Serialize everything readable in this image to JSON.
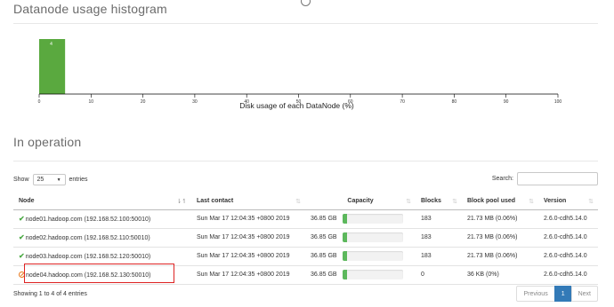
{
  "histogram": {
    "title": "Datanode usage histogram"
  },
  "chart_data": {
    "type": "bar",
    "title": "",
    "xlabel": "Disk usage of each DataNode (%)",
    "ylabel": "",
    "xlim": [
      0,
      100
    ],
    "x_ticks": [
      0,
      10,
      20,
      30,
      40,
      50,
      60,
      70,
      80,
      90,
      100
    ],
    "bins": [
      {
        "start": 0,
        "end": 5,
        "count": 4
      }
    ],
    "bar_color": "#5aa93f",
    "grid": false
  },
  "operation": {
    "title": "In operation",
    "show_label": "Show",
    "entries_label": "entries",
    "page_size": "25",
    "search_label": "Search:",
    "search_value": "",
    "columns": [
      "Node",
      "Last contact",
      "Capacity",
      "Blocks",
      "Block pool used",
      "Version"
    ],
    "rows": [
      {
        "status": "check-icon",
        "node": "node01.hadoop.com (192.168.52.100:50010)",
        "last_contact": "Sun Mar 17 12:04:35 +0800 2019",
        "capacity": "36.85 GB",
        "usage": 0.06,
        "blocks": "183",
        "pool_used": "21.73 MB (0.06%)",
        "version": "2.6.0-cdh5.14.0"
      },
      {
        "status": "check-icon",
        "node": "node02.hadoop.com (192.168.52.110:50010)",
        "last_contact": "Sun Mar 17 12:04:35 +0800 2019",
        "capacity": "36.85 GB",
        "usage": 0.06,
        "blocks": "183",
        "pool_used": "21.73 MB (0.06%)",
        "version": "2.6.0-cdh5.14.0"
      },
      {
        "status": "check-icon",
        "node": "node03.hadoop.com (192.168.52.120:50010)",
        "last_contact": "Sun Mar 17 12:04:35 +0800 2019",
        "capacity": "36.85 GB",
        "usage": 0.06,
        "blocks": "183",
        "pool_used": "21.73 MB (0.06%)",
        "version": "2.6.0-cdh5.14.0"
      },
      {
        "status": "decommission-icon",
        "node": "node04.hadoop.com (192.168.52.130:50010)",
        "last_contact": "Sun Mar 17 12:04:35 +0800 2019",
        "capacity": "36.85 GB",
        "usage": 0.06,
        "blocks": "0",
        "pool_used": "36 KB (0%)",
        "version": "2.6.0-cdh5.14.0"
      }
    ],
    "info": "Showing 1 to 4 of 4 entries",
    "pagination": {
      "previous": "Previous",
      "current": "1",
      "next": "Next"
    }
  },
  "colors": {
    "accent": "#337ab7",
    "ok": "#4caa45",
    "warning": "#e8781a",
    "highlight": "#dd2222",
    "bar": "#5cb85c"
  }
}
